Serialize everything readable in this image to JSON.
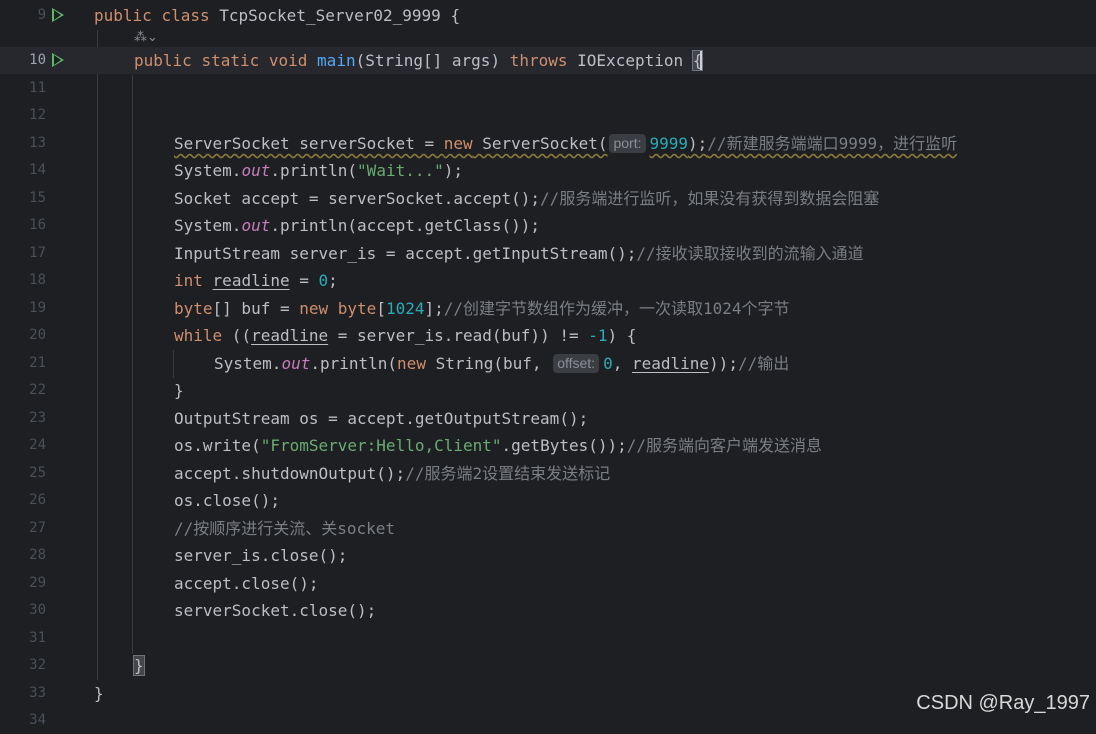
{
  "editor": {
    "gutter_line_numbers": [
      "9",
      "10",
      "11",
      "12",
      "13",
      "14",
      "15",
      "16",
      "17",
      "18",
      "19",
      "20",
      "21",
      "22",
      "23",
      "24",
      "25",
      "26",
      "27",
      "28",
      "29",
      "30",
      "31",
      "32",
      "33",
      "34"
    ],
    "line_9": {
      "t1": "public",
      "t2": "class",
      "t3": "TcpSocket_Server02_9999 {"
    },
    "annotation_icon": "⁂⌄",
    "line_10": {
      "t1": "public",
      "t2": "static",
      "t3": "void",
      "t4": "main",
      "t5": "(String[] args)",
      "t6": "throws",
      "t7": "IOException",
      "t8": "{"
    },
    "line_13": {
      "t1": "ServerSocket serverSocket = ",
      "t2": "new",
      "t3": " ServerSocket(",
      "hint": "port:",
      "t4": "9999",
      "t5": ");",
      "t6": "//新建服务端端口9999，进行监听"
    },
    "line_14": {
      "t1": "System.",
      "t2": "out",
      "t3": ".println(",
      "t4": "\"Wait...\"",
      "t5": ");"
    },
    "line_15": {
      "t1": "Socket accept = serverSocket.accept();",
      "t2": "//服务端进行监听，如果没有获得到数据会阻塞"
    },
    "line_16": {
      "t1": "System.",
      "t2": "out",
      "t3": ".println(accept.getClass());"
    },
    "line_17": {
      "t1": "InputStream server_is = accept.getInputStream();",
      "t2": "//接收读取接收到的流输入通道"
    },
    "line_18": {
      "t1": "int",
      "t2": "readline",
      "t3": " = ",
      "t4": "0",
      "t5": ";"
    },
    "line_19": {
      "t1": "byte",
      "t2": "[] buf = ",
      "t3": "new",
      "t4": "byte",
      "t5": "[",
      "t6": "1024",
      "t7": "];",
      "t8": "//创建字节数组作为缓冲，一次读取1024个字节"
    },
    "line_20": {
      "t1": "while",
      "t2": " ((",
      "t3": "readline",
      "t4": " = server_is.read(buf)) != ",
      "t5": "-1",
      "t6": ") {"
    },
    "line_21": {
      "t1": "System.",
      "t2": "out",
      "t3": ".println(",
      "t4": "new",
      "t5": " String(buf, ",
      "hint": "offset:",
      "t6": "0",
      "t7": ", ",
      "t8": "readline",
      "t9": "));",
      "t10": "//输出"
    },
    "line_22": {
      "t1": "}"
    },
    "line_23": {
      "t1": "OutputStream os = accept.getOutputStream();"
    },
    "line_24": {
      "t1": "os.write(",
      "t2": "\"FromServer:Hello,Client\"",
      "t3": ".getBytes());",
      "t4": "//服务端向客户端发送消息"
    },
    "line_25": {
      "t1": "accept.shutdownOutput();",
      "t2": "//服务端2设置结束发送标记"
    },
    "line_26": {
      "t1": "os.close();"
    },
    "line_27": {
      "t1": "//按顺序进行关流、关socket"
    },
    "line_28": {
      "t1": "server_is.close();"
    },
    "line_29": {
      "t1": "accept.close();"
    },
    "line_30": {
      "t1": "serverSocket.close();"
    },
    "line_32": {
      "t1": "}"
    },
    "line_33": {
      "t1": "}"
    }
  },
  "watermark": "CSDN @Ray_1997",
  "colors": {
    "background": "#1e1f22",
    "current_line": "#26282e",
    "keyword": "#cf8e6d",
    "function": "#56a8f5",
    "number": "#2aacb8",
    "string": "#6aab73",
    "comment": "#7a7e85",
    "static_field": "#c77dbb",
    "run_icon": "#5fb865"
  }
}
